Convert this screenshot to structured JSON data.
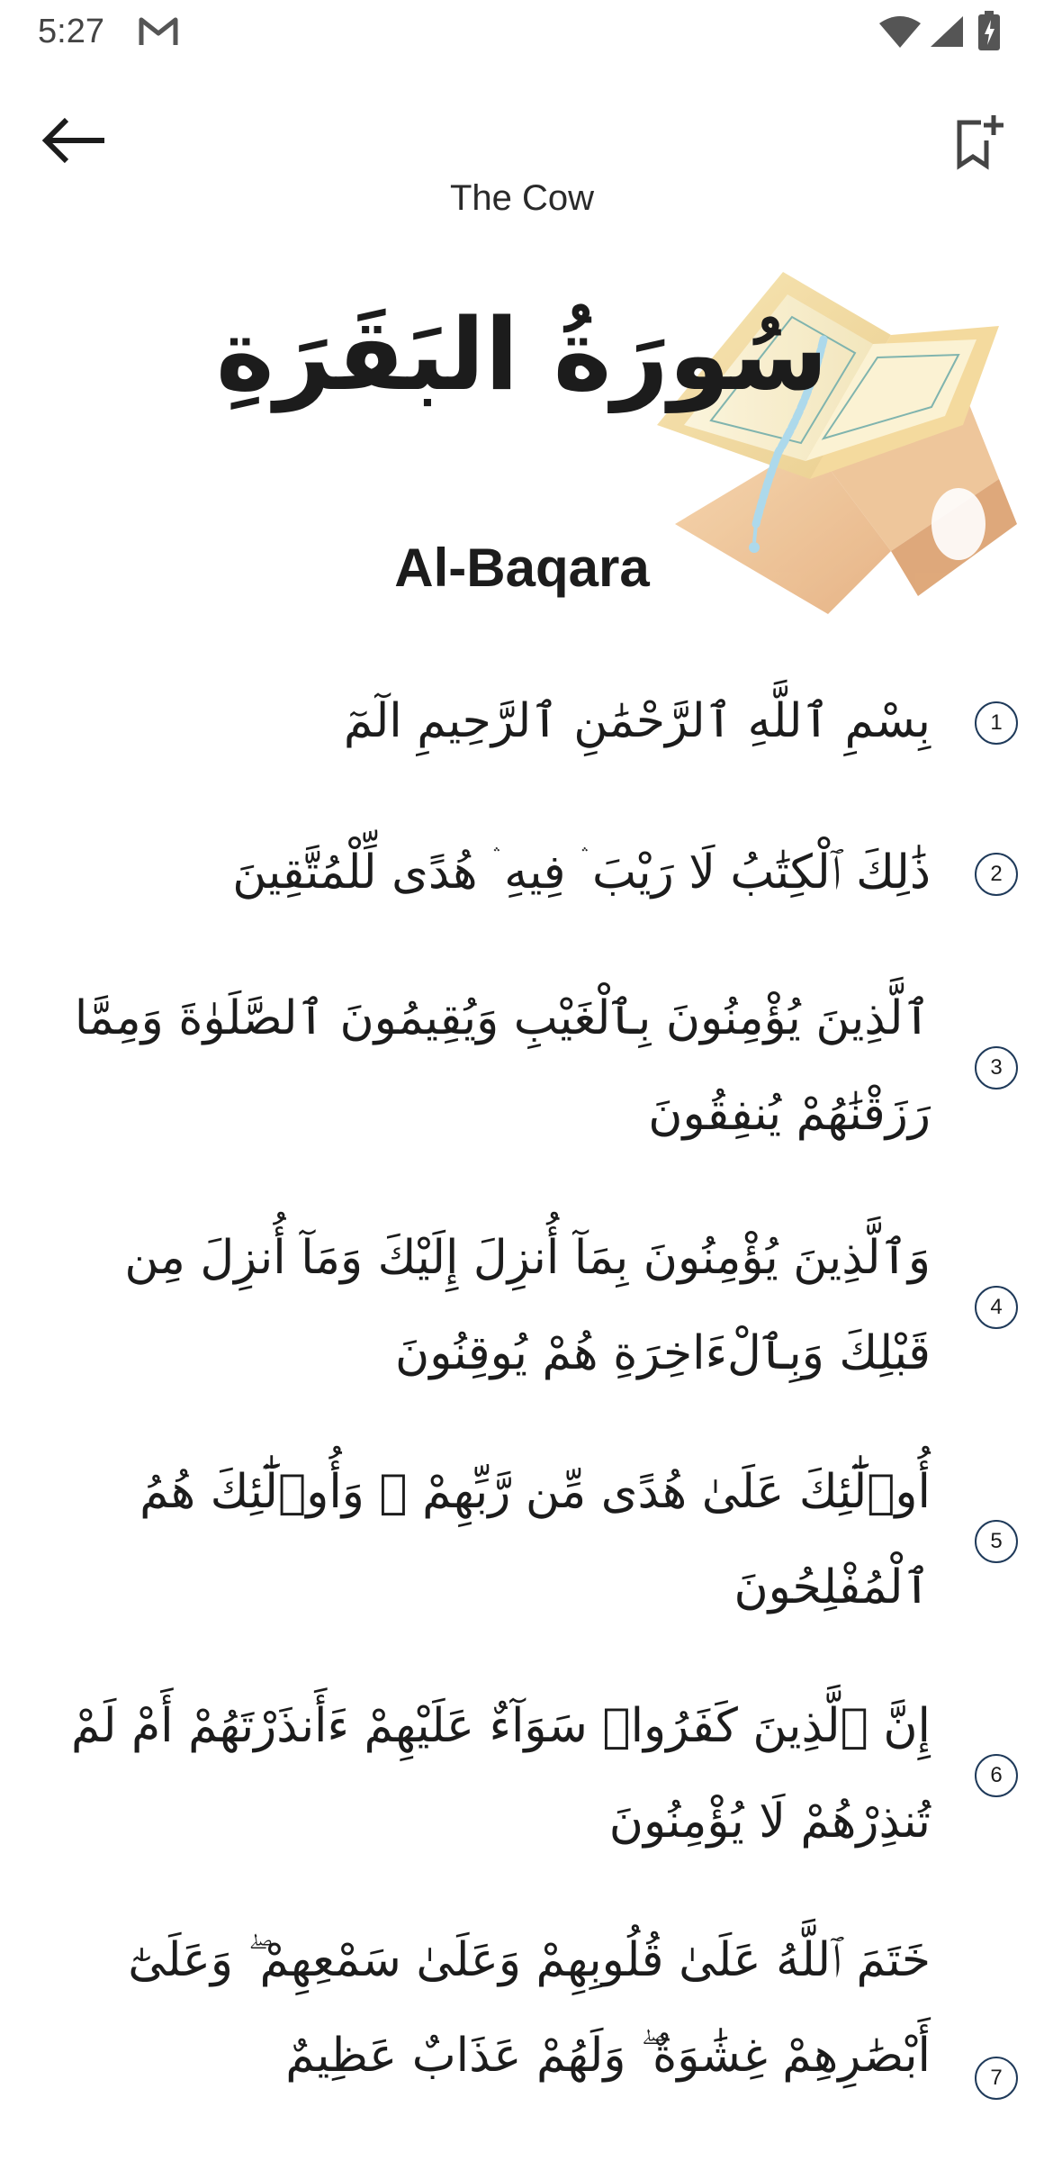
{
  "status_bar": {
    "time": "5:27",
    "icons": [
      "gmail-icon",
      "wifi-icon",
      "signal-icon",
      "battery-icon"
    ]
  },
  "app_bar": {
    "back_icon": "arrow-left-icon",
    "bookmark_icon": "bookmark-add-icon"
  },
  "surah": {
    "english_name": "The Cow",
    "arabic_name": "سُورَةُ البَقَرَةِ",
    "transliteration": "Al-Baqara"
  },
  "verses": [
    {
      "number": "1",
      "text": "بِسْمِ ٱللَّهِ ٱلرَّحْمَٰنِ ٱلرَّحِيمِ الٓمٓ"
    },
    {
      "number": "2",
      "text": "ذَٰلِكَ ٱلْكِتَٰبُ لَا رَيْبَ ۛ فِيهِ ۛ هُدًى لِّلْمُتَّقِينَ"
    },
    {
      "number": "3",
      "text": "ٱلَّذِينَ يُؤْمِنُونَ بِٱلْغَيْبِ وَيُقِيمُونَ ٱلصَّلَوٰةَ وَمِمَّا رَزَقْنَٰهُمْ يُنفِقُونَ"
    },
    {
      "number": "4",
      "text": "وَٱلَّذِينَ يُؤْمِنُونَ بِمَآ أُنزِلَ إِلَيْكَ وَمَآ أُنزِلَ مِن قَبْلِكَ وَبِٱلْءَاخِرَةِ هُمْ يُوقِنُونَ"
    },
    {
      "number": "5",
      "text": "أُو۟لَٰٓئِكَ عَلَىٰ هُدًى مِّن رَّبِّهِمْ ۖ وَأُو۟لَٰٓئِكَ هُمُ ٱلْمُفْلِحُونَ"
    },
    {
      "number": "6",
      "text": "إِنَّ ٱلَّذِينَ كَفَرُوا۟ سَوَآءٌ عَلَيْهِمْ ءَأَنذَرْتَهُمْ أَمْ لَمْ تُنذِرْهُمْ لَا يُؤْمِنُونَ"
    },
    {
      "number": "7",
      "text": "خَتَمَ ٱللَّهُ عَلَىٰ قُلُوبِهِمْ وَعَلَىٰ سَمْعِهِمْ ۖ وَعَلَىٰٓ أَبْصَٰرِهِمْ غِشَٰوَةٌ ۖ وَلَهُمْ عَذَابٌ عَظِيمٌ"
    }
  ]
}
